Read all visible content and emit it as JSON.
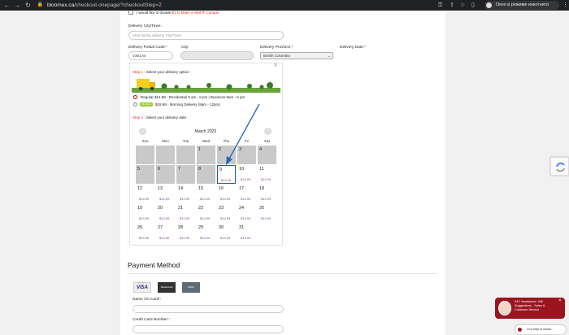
{
  "browser": {
    "url_domain": "bioomex.ca",
    "url_path": "/checkout-onepage/?checkoutStep=2",
    "incognito_label": "Окно в режиме инкогнито"
  },
  "form": {
    "donate_text": "I would like to donate",
    "donate_link": "$1 to Make a Wish® Canada",
    "city_label": "Delivery City/Town:",
    "city_placeholder": "Start typing delivery City/Town",
    "postal_label": "Delivery Postal Code:",
    "postal_value": "V3K1A4",
    "city2_label": "City:",
    "province_label": "Delivery Province:",
    "province_value": "British Columbia",
    "date_label": "Delivery Date:",
    "req": "*"
  },
  "step1": {
    "step": "Step 1",
    "text": " : Select your delivery option :",
    "regular": "Regular $14.99 - Residential 9 am - 8 pm | Business 9am - 5 pm",
    "morning": "$18.98 - Morning Delivery (9am - 12pm)",
    "morning_badge": "Morning"
  },
  "step2": {
    "step": "Step 2",
    "text": " : Select your delivery date :"
  },
  "calendar": {
    "month": "March 2023",
    "dow": [
      "Sun",
      "Mon",
      "Tue",
      "Wed",
      "Thu",
      "Fri",
      "Sat"
    ],
    "weeks": [
      [
        {
          "d": "",
          "off": true
        },
        {
          "d": "",
          "off": true
        },
        {
          "d": "",
          "off": true
        },
        {
          "d": "1",
          "off": true
        },
        {
          "d": "2",
          "off": true
        },
        {
          "d": "3",
          "off": true
        },
        {
          "d": "4",
          "off": true
        }
      ],
      [
        {
          "d": "5",
          "off": true
        },
        {
          "d": "6",
          "off": true
        },
        {
          "d": "7",
          "off": true
        },
        {
          "d": "8",
          "off": true
        },
        {
          "d": "9",
          "p": "$14.99",
          "sel": true
        },
        {
          "d": "10",
          "p": "$14.99"
        },
        {
          "d": "11",
          "p": "$14.99"
        }
      ],
      [
        {
          "d": "12",
          "p": "$14.99"
        },
        {
          "d": "13",
          "p": "$14.99"
        },
        {
          "d": "14",
          "p": "$14.99"
        },
        {
          "d": "15",
          "p": "$14.99"
        },
        {
          "d": "16",
          "p": "$14.99"
        },
        {
          "d": "17",
          "p": "$14.99"
        },
        {
          "d": "18",
          "p": "$14.99"
        }
      ],
      [
        {
          "d": "19",
          "p": "$14.99"
        },
        {
          "d": "20",
          "p": "$14.99"
        },
        {
          "d": "21",
          "p": "$14.99"
        },
        {
          "d": "22",
          "p": "$14.99"
        },
        {
          "d": "23",
          "p": "$14.99"
        },
        {
          "d": "24",
          "p": "$14.99"
        },
        {
          "d": "25",
          "p": "$14.99"
        }
      ],
      [
        {
          "d": "26",
          "p": "$14.99"
        },
        {
          "d": "27",
          "p": "$14.99"
        },
        {
          "d": "28",
          "p": "$14.99"
        },
        {
          "d": "29",
          "p": "$14.99"
        },
        {
          "d": "30",
          "p": "$14.99"
        },
        {
          "d": "31",
          "p": "$14.99"
        },
        {
          "d": ""
        }
      ]
    ]
  },
  "payment": {
    "title": "Payment Method",
    "visa": "VISA",
    "mc": "MasterCard",
    "amex": "AMEX",
    "name_label": "Name On Card",
    "number_label": "Credit Card Number",
    "req": "*"
  },
  "chat": {
    "text": "24/7 Assistance: Gift Suggestions - Sales & Customer Service",
    "close": "×",
    "live": "Live help is online..."
  },
  "colors": {
    "accent": "#d32f2f",
    "selected": "#1f56b4",
    "chat": "#9b1521"
  }
}
